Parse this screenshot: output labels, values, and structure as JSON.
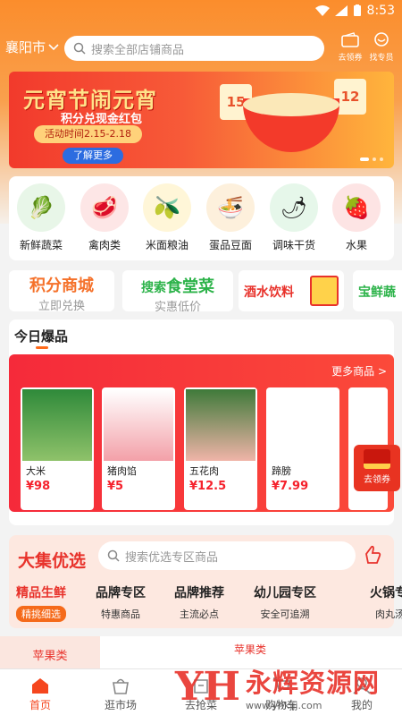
{
  "status": {
    "time": "8:53"
  },
  "header": {
    "city": "襄阳市",
    "search_placeholder": "搜索全部店铺商品",
    "icon1_label": "去领券",
    "icon2_label": "找专员"
  },
  "banner": {
    "title": "元宵节闹元宵",
    "subtitle": "积分兑现金红包",
    "time": "活动时间2.15-2.18",
    "button": "了解更多",
    "cal1": "15",
    "cal2": "12"
  },
  "categories": [
    {
      "label": "新鲜蔬菜",
      "icon": "vegetable-icon",
      "color": "#e8f6e8",
      "glyph": "🥬"
    },
    {
      "label": "禽肉类",
      "icon": "meat-icon",
      "color": "#fde6e6",
      "glyph": "🥩"
    },
    {
      "label": "米面粮油",
      "icon": "oil-icon",
      "color": "#fff6d8",
      "glyph": "🫒"
    },
    {
      "label": "蛋品豆面",
      "icon": "noodle-icon",
      "color": "#fdf0dc",
      "glyph": "🍜"
    },
    {
      "label": "调味干货",
      "icon": "sauce-icon",
      "color": "#e6f7ea",
      "glyph": "🌶"
    },
    {
      "label": "水果",
      "icon": "strawberry-icon",
      "color": "#fde4e4",
      "glyph": "🍓"
    }
  ],
  "promos": [
    {
      "title": "积分商城",
      "sub": "立即兑换",
      "color": "#f5712a"
    },
    {
      "title_a": "搜索",
      "title_b": "食堂菜",
      "sub": "实惠低价",
      "color": "#2db34a"
    },
    {
      "title": "酒水饮料",
      "color": "#e8322b"
    },
    {
      "title": "宝鲜蔬",
      "color": "#2db34a"
    }
  ],
  "today": {
    "title": "今日爆品",
    "more": "更多商品 >",
    "products": [
      {
        "name": "大米",
        "price": "¥98"
      },
      {
        "name": "猪肉馅",
        "price": "¥5"
      },
      {
        "name": "五花肉",
        "price": "¥12.5"
      },
      {
        "name": "蹄膀",
        "price": "¥7.99"
      },
      {
        "name": "",
        "price": "¥"
      }
    ],
    "coupon": "去领券"
  },
  "daji": {
    "title": "大集优选",
    "search_placeholder": "搜索优选专区商品",
    "tabs": [
      {
        "title": "精品生鲜",
        "sub": "精挑细选",
        "active": true
      },
      {
        "title": "品牌专区",
        "sub": "特惠商品",
        "active": false
      },
      {
        "title": "品牌推荐",
        "sub": "主流必点",
        "active": false
      },
      {
        "title": "幼儿园专区",
        "sub": "安全可追溯",
        "active": false
      },
      {
        "title": "火锅专区",
        "sub": "肉丸汤料",
        "active": false
      }
    ]
  },
  "fruit": {
    "left": "苹果类",
    "right": "苹果类"
  },
  "nav": [
    {
      "label": "首页",
      "active": true
    },
    {
      "label": "逛市场",
      "active": false
    },
    {
      "label": "去抢菜",
      "active": false
    },
    {
      "label": "购物车",
      "active": false
    },
    {
      "label": "我的",
      "active": false
    }
  ],
  "watermark": {
    "logo": "YH",
    "name": "永辉资源网",
    "url": "www.yhkjjj.com"
  }
}
